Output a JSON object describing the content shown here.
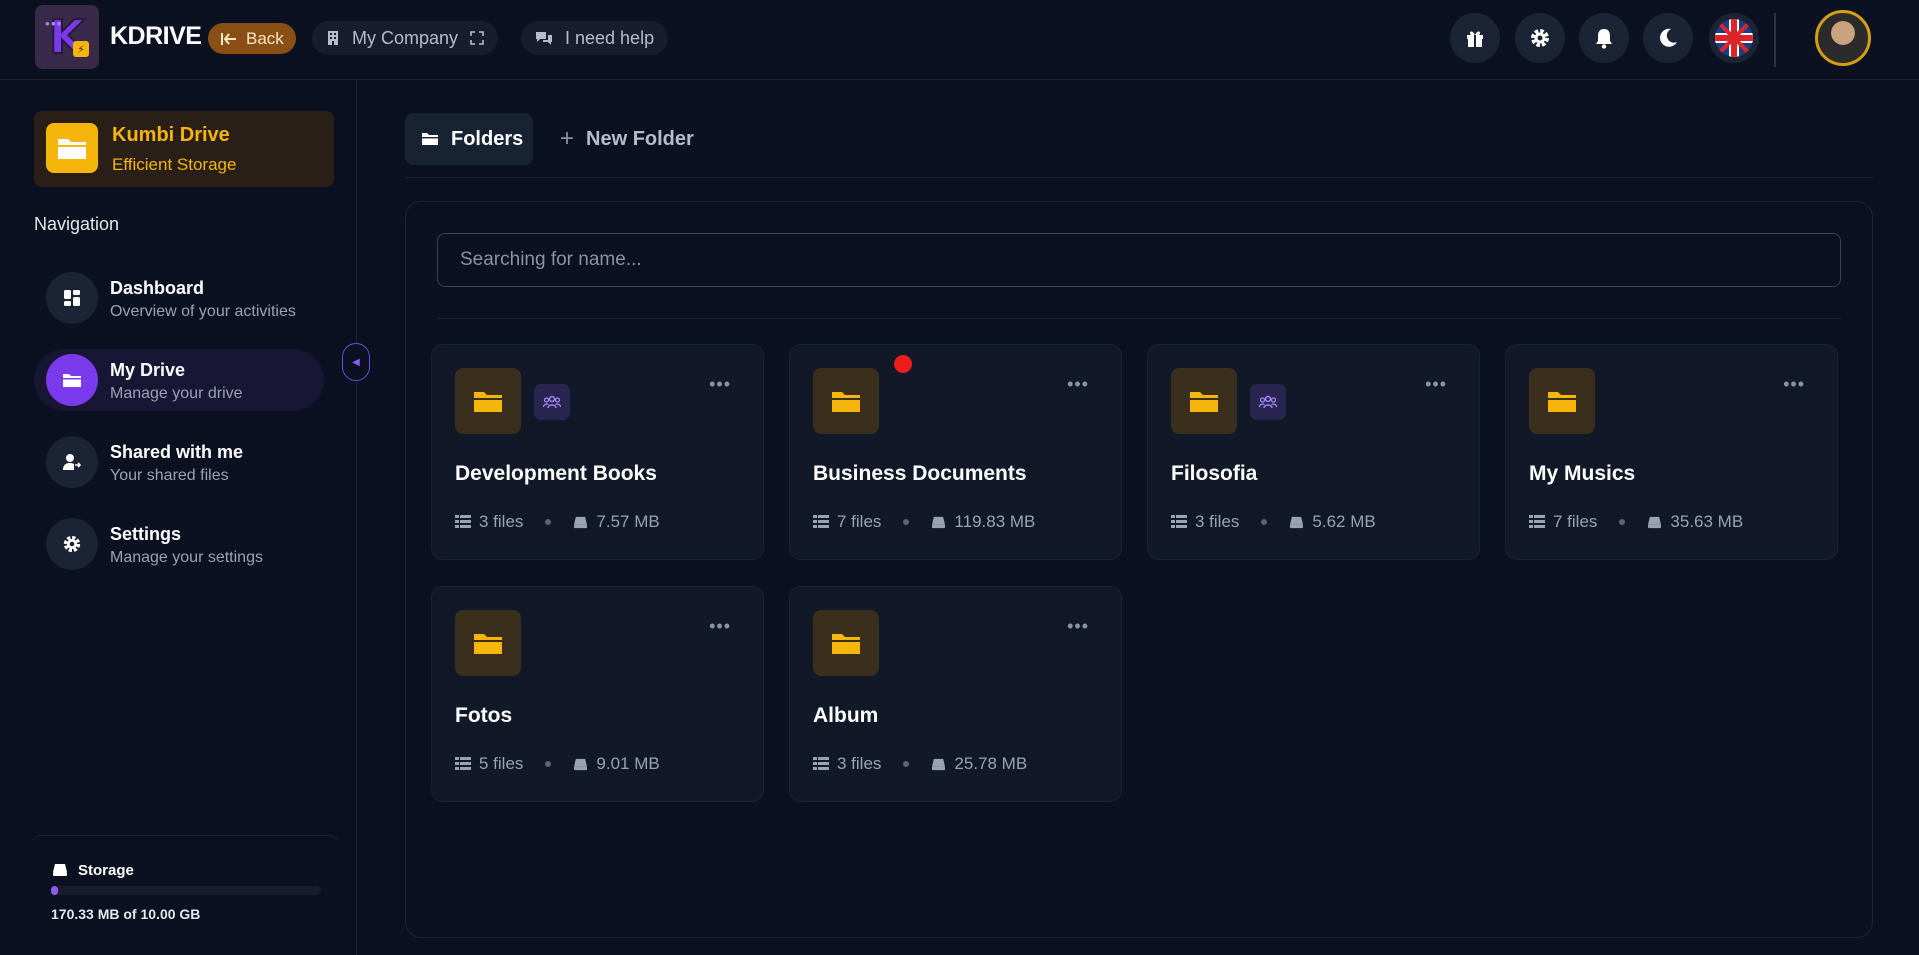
{
  "header": {
    "brand": "KDRIVE",
    "back_label": "Back",
    "company_label": "My Company",
    "help_label": "I need help",
    "icons": [
      "gift-icon",
      "gear-icon",
      "bell-icon",
      "moon-icon",
      "uk-flag-icon"
    ]
  },
  "sidebar": {
    "drive_title": "Kumbi Drive",
    "drive_subtitle": "Efficient Storage",
    "nav_heading": "Navigation",
    "items": [
      {
        "title": "Dashboard",
        "subtitle": "Overview of your activities",
        "icon": "dashboard-icon"
      },
      {
        "title": "My Drive",
        "subtitle": "Manage your drive",
        "icon": "folder-icon",
        "active": true
      },
      {
        "title": "Shared with me",
        "subtitle": "Your shared files",
        "icon": "shared-user-icon"
      },
      {
        "title": "Settings",
        "subtitle": "Manage your settings",
        "icon": "gear-icon"
      }
    ],
    "storage": {
      "title": "Storage",
      "text": "170.33 MB of 10.00 GB",
      "used_fraction": 0.017
    }
  },
  "main": {
    "tabs": [
      {
        "label": "Folders",
        "active": true
      },
      {
        "label": "New Folder"
      }
    ],
    "search_placeholder": "Searching for name...",
    "folders": [
      {
        "name": "Development Books",
        "files": "3 files",
        "size": "7.57 MB",
        "shared": true,
        "notification": false
      },
      {
        "name": "Business Documents",
        "files": "7 files",
        "size": "119.83 MB",
        "shared": false,
        "notification": true
      },
      {
        "name": "Filosofia",
        "files": "3 files",
        "size": "5.62 MB",
        "shared": true,
        "notification": false
      },
      {
        "name": "My Musics",
        "files": "7 files",
        "size": "35.63 MB",
        "shared": false,
        "notification": false
      },
      {
        "name": "Fotos",
        "files": "5 files",
        "size": "9.01 MB",
        "shared": false,
        "notification": false
      },
      {
        "name": "Album",
        "files": "3 files",
        "size": "25.78 MB",
        "shared": false,
        "notification": false
      }
    ]
  },
  "colors": {
    "background": "#0b1120",
    "accent_purple": "#7c3aed",
    "accent_yellow": "#f5b50b",
    "card": "#111827"
  }
}
